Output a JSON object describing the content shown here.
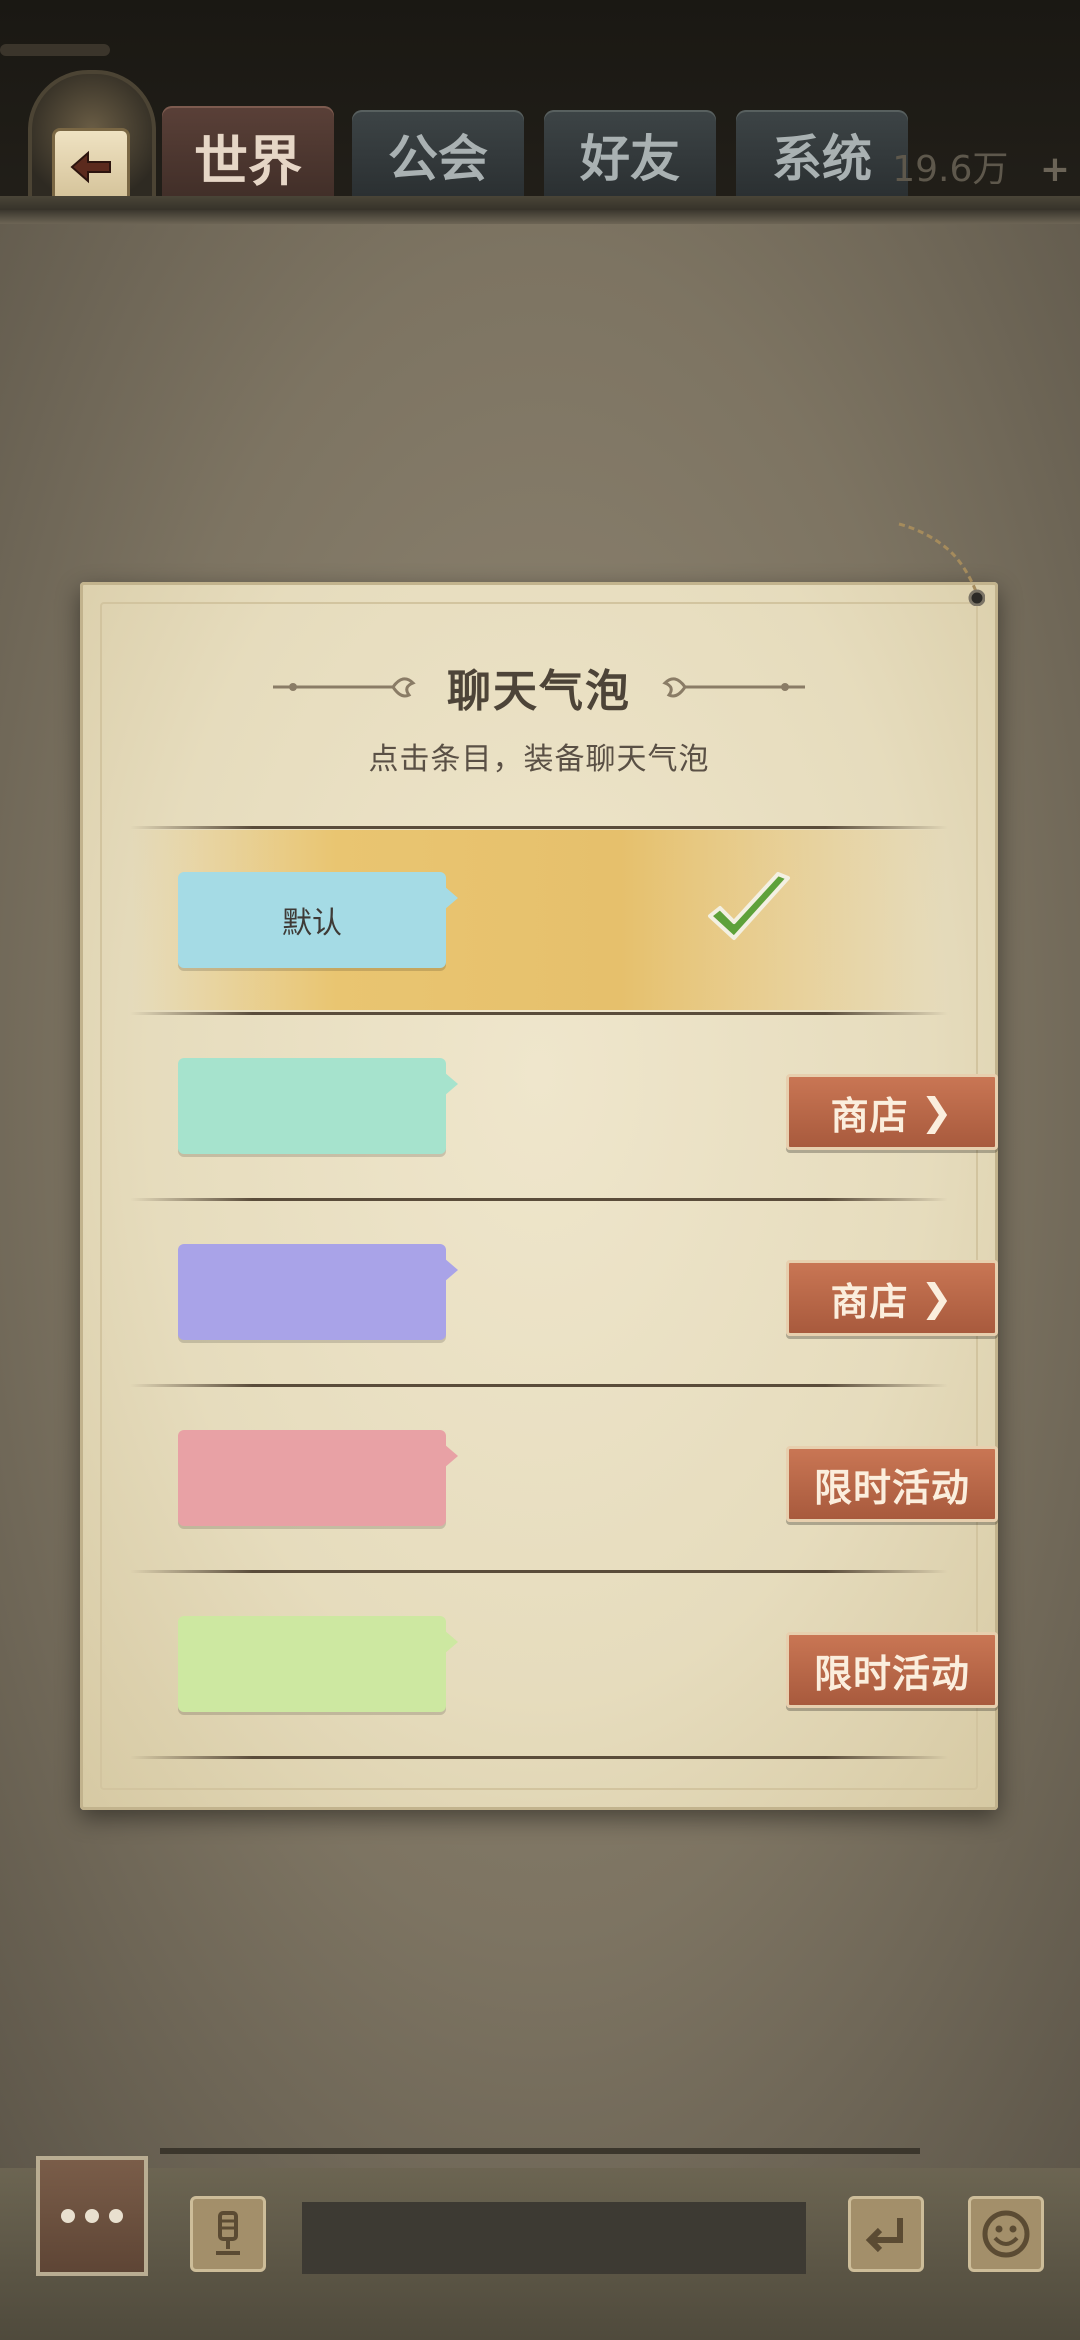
{
  "header": {
    "tabs": [
      {
        "label": "世界",
        "active": true
      },
      {
        "label": "公会",
        "active": false
      },
      {
        "label": "好友",
        "active": false
      },
      {
        "label": "系统",
        "active": false
      }
    ],
    "currency": "19.6万",
    "currency_plus": "+"
  },
  "dialog": {
    "title": "聊天气泡",
    "subtitle": "点击条目，装备聊天气泡",
    "items": [
      {
        "bubble_label": "默认",
        "bubble_color": "#a5dbe5",
        "equipped": true,
        "action": ""
      },
      {
        "bubble_label": "",
        "bubble_color": "#a6e3cd",
        "equipped": false,
        "action": "商店",
        "action_chevron": "❯"
      },
      {
        "bubble_label": "",
        "bubble_color": "#a9a3e8",
        "equipped": false,
        "action": "商店",
        "action_chevron": "❯"
      },
      {
        "bubble_label": "",
        "bubble_color": "#e8a1a5",
        "equipped": false,
        "action": "限时活动"
      },
      {
        "bubble_label": "",
        "bubble_color": "#cde8a1",
        "equipped": false,
        "action": "限时活动"
      }
    ]
  },
  "chatbar": {
    "input_value": "",
    "icons": [
      "more-icon",
      "microphone-icon",
      "enter-icon",
      "emoji-icon"
    ]
  },
  "colors": {
    "accent_button": "#b8633f",
    "selected_row": "#e8c36f",
    "check_green": "#5ea13a"
  }
}
